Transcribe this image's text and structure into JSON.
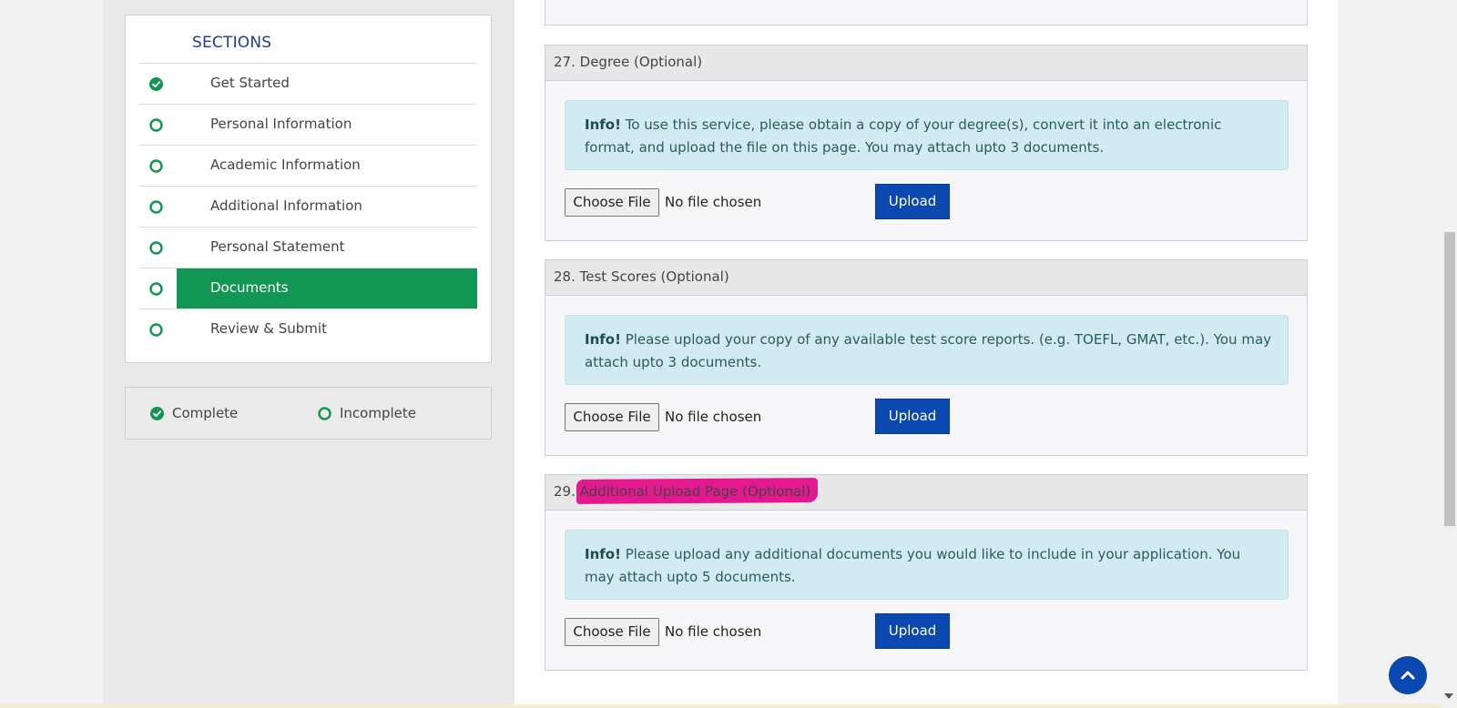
{
  "sidebar": {
    "title": "SECTIONS",
    "items": [
      {
        "label": "Get Started",
        "status": "complete"
      },
      {
        "label": "Personal Information",
        "status": "incomplete"
      },
      {
        "label": "Academic Information",
        "status": "incomplete"
      },
      {
        "label": "Additional Information",
        "status": "incomplete"
      },
      {
        "label": "Personal Statement",
        "status": "incomplete"
      },
      {
        "label": "Documents",
        "status": "incomplete",
        "active": true
      },
      {
        "label": "Review & Submit",
        "status": "incomplete"
      }
    ]
  },
  "legend": {
    "complete_label": "Complete",
    "incomplete_label": "Incomplete"
  },
  "panels": [
    {
      "number": "27.",
      "title": "Degree (Optional)",
      "info_label": "Info!",
      "info_text": "To use this service, please obtain a copy of your degree(s), convert it into an electronic format, and upload the file on this page. You may attach upto 3 documents.",
      "choose_label": "Choose File",
      "file_status": "No file chosen",
      "upload_label": "Upload"
    },
    {
      "number": "28.",
      "title": "Test Scores (Optional)",
      "info_label": "Info!",
      "info_text": "Please upload your copy of any available test score reports. (e.g. TOEFL, GMAT, etc.). You may attach upto 3 documents.",
      "choose_label": "Choose File",
      "file_status": "No file chosen",
      "upload_label": "Upload"
    },
    {
      "number": "29.",
      "title": "Additional Upload Page (Optional)",
      "info_label": "Info!",
      "info_text": "Please upload any additional documents you would like to include in your application. You may attach upto 5 documents.",
      "choose_label": "Choose File",
      "file_status": "No file chosen",
      "upload_label": "Upload"
    }
  ],
  "colors": {
    "complete": "#129653",
    "active_bg": "#129653",
    "primary_button": "#0b49b0",
    "info_bg": "#d2ebf0",
    "annotation_highlight": "#e6188f"
  },
  "icons": {
    "complete": "check-circle-icon",
    "incomplete": "empty-circle-icon",
    "back_to_top": "chevron-up-icon"
  }
}
